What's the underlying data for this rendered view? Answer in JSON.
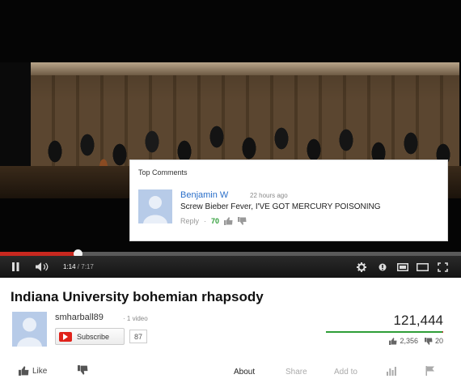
{
  "player": {
    "current_time": "1:14",
    "separator": " / ",
    "duration": "7:17",
    "progress_fraction": 0.169
  },
  "comment": {
    "header": "Top Comments",
    "author": "Benjamin W",
    "age": "22 hours ago",
    "text": "Screw Bieber Fever, I'VE GOT MERCURY POISONING",
    "reply_label": "Reply",
    "dot": "·",
    "likes": "70"
  },
  "video": {
    "title": "Indiana University bohemian rhapsody",
    "channel_name": "smharball89",
    "channel_dot": "·",
    "channel_videos": "1 video",
    "subscribe_label": "Subscribe",
    "subscriber_count": "87",
    "views": "121,444",
    "likes": "2,356",
    "dislikes": "20",
    "like_ratio": 0.9916
  },
  "actions": {
    "like_label": "Like",
    "about_label": "About",
    "share_label": "Share",
    "addto_label": "Add to"
  },
  "colors": {
    "progress_played": "#c8281f",
    "link_blue": "#2a6fc9",
    "like_green": "#2f9e38",
    "subscribe_red": "#e0221a"
  },
  "icons": [
    "play-pause-icon",
    "volume-icon",
    "settings-gear-icon",
    "annotations-icon",
    "small-player-icon",
    "large-player-icon",
    "fullscreen-icon",
    "thumbs-up-icon",
    "thumbs-down-icon",
    "stats-icon",
    "flag-icon"
  ]
}
